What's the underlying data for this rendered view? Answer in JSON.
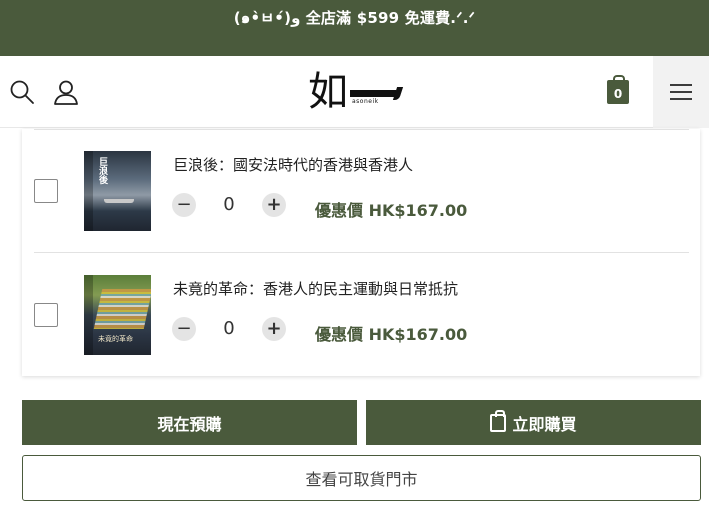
{
  "promo": {
    "text": "(๑•̀ㅂ•́)و 全店滿 $599 免運費.ᐟ.ᐟ"
  },
  "header": {
    "search_icon": "search-icon",
    "account_icon": "user-icon",
    "logo_text": "如",
    "logo_sub": "asoneik",
    "cart_icon": "shopping-bag-icon",
    "cart_count": "0",
    "menu_icon": "hamburger-menu-icon"
  },
  "items": [
    {
      "title": "巨浪後：國安法時代的香港與香港人",
      "cover_title": "巨浪後",
      "quantity": "0",
      "price": "優惠價 HK$167.00",
      "minus": "−",
      "plus": "+"
    },
    {
      "title": "未竟的革命：香港人的民主運動與日常抵抗",
      "cover_caption": "未竟的革命",
      "quantity": "0",
      "price": "優惠價 HK$167.00",
      "minus": "−",
      "plus": "+"
    }
  ],
  "actions": {
    "preorder_label": "現在預購",
    "buy_now_label": "立即購買",
    "store_availability_label": "查看可取貨門市"
  },
  "colors": {
    "brand_green": "#4a5a3c",
    "menu_bg": "#f2f2f2"
  }
}
